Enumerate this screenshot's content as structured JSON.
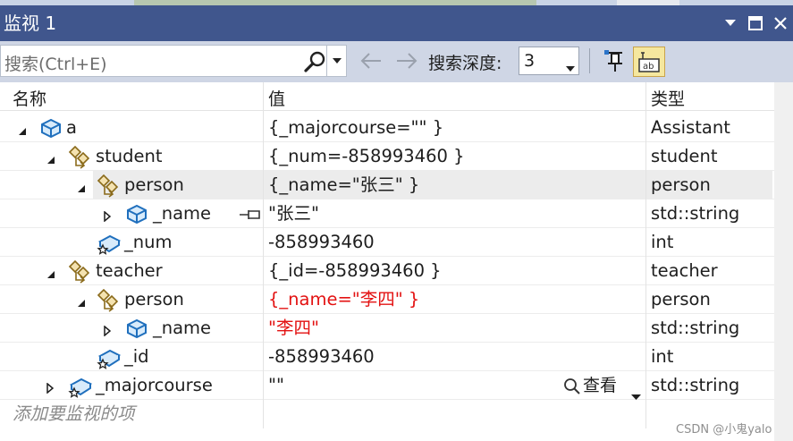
{
  "window": {
    "title": "监视 1"
  },
  "toolbar": {
    "search_placeholder": "搜索(Ctrl+E)",
    "depth_label": "搜索深度:",
    "depth_value": "3"
  },
  "columns": {
    "name": "名称",
    "value": "值",
    "type": "类型"
  },
  "rows": [
    {
      "name": "a",
      "value": "{_majorcourse=\"\" }",
      "type": "Assistant"
    },
    {
      "name": "student",
      "value": "{_num=-858993460 }",
      "type": "student"
    },
    {
      "name": "person",
      "value": "{_name=\"张三\" }",
      "type": "person"
    },
    {
      "name": "_name",
      "value": "\"张三\"",
      "type": "std::string"
    },
    {
      "name": "_num",
      "value": "-858993460",
      "type": "int"
    },
    {
      "name": "teacher",
      "value": "{_id=-858993460 }",
      "type": "teacher"
    },
    {
      "name": "person",
      "value": "{_name=\"李四\" }",
      "type": "person"
    },
    {
      "name": "_name",
      "value": "\"李四\"",
      "type": "std::string"
    },
    {
      "name": "_id",
      "value": "-858993460",
      "type": "int"
    },
    {
      "name": "_majorcourse",
      "value": "\"\"",
      "type": "std::string",
      "view_label": "查看"
    }
  ],
  "add_watch_placeholder": "添加要监视的项",
  "watermark": "CSDN @小鬼yalo",
  "colors": {
    "titlebar": "#40568d",
    "toolbar": "#cfd6e5",
    "changed_value": "#e31212",
    "selected_row": "#ececec"
  }
}
